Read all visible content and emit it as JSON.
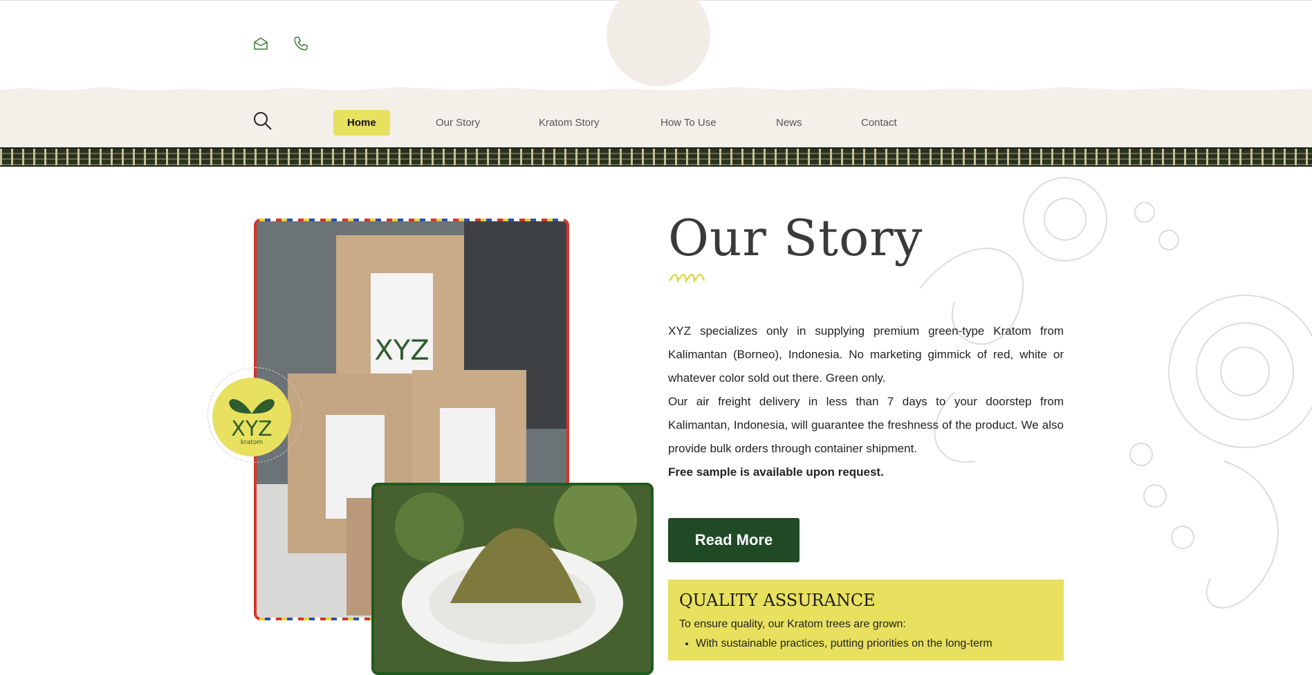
{
  "header": {
    "icons": [
      "email-icon",
      "phone-icon"
    ]
  },
  "nav": {
    "items": [
      {
        "label": "Home",
        "active": true
      },
      {
        "label": "Our Story",
        "active": false
      },
      {
        "label": "Kratom Story",
        "active": false
      },
      {
        "label": "How To Use",
        "active": false
      },
      {
        "label": "News",
        "active": false
      },
      {
        "label": "Contact",
        "active": false
      }
    ]
  },
  "story": {
    "title": "Our Story",
    "paragraph1": "XYZ specializes only in supplying premium green-type Kratom from Kalimantan (Borneo), Indonesia. No marketing gimmick of red, white or whatever color sold out there. Green only.",
    "paragraph2": "Our air freight delivery in less than 7 days to your doorstep from Kalimantan, Indonesia, will guarantee the freshness of the product. We also provide bulk orders through container shipment.",
    "paragraph3": "Free sample is available upon request.",
    "button": "Read More"
  },
  "logo": {
    "brand": "XYZ",
    "sub": "kratom"
  },
  "quality": {
    "title": "QUALITY ASSURANCE",
    "intro": "To ensure quality, our Kratom trees are grown:",
    "items": [
      "With sustainable practices, putting priorities on the long-term"
    ]
  },
  "colors": {
    "accent_yellow": "#e8e05f",
    "button_green": "#1f4a25",
    "nav_band": "#f3f0ea"
  }
}
